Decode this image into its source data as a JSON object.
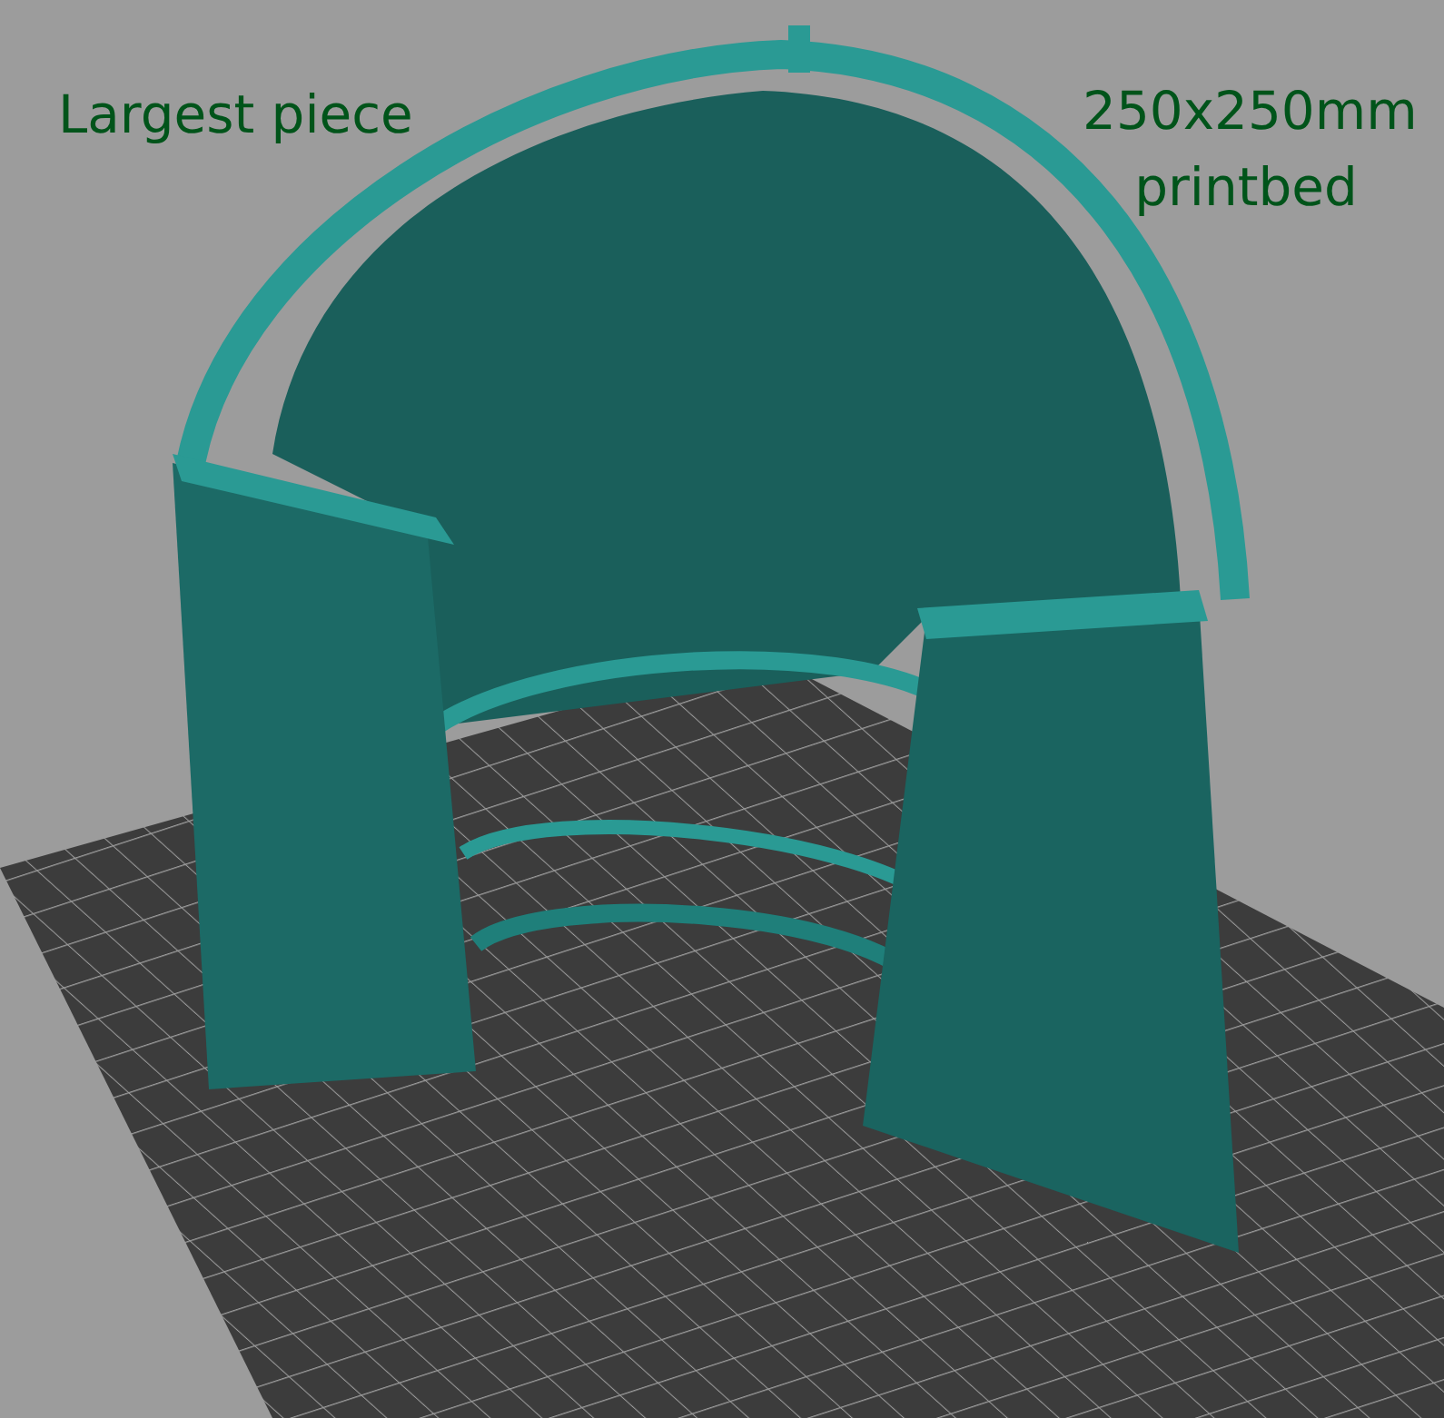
{
  "viewport": {
    "model_label": "Largest piece",
    "bed_size_label": "250x250mm printbed"
  }
}
